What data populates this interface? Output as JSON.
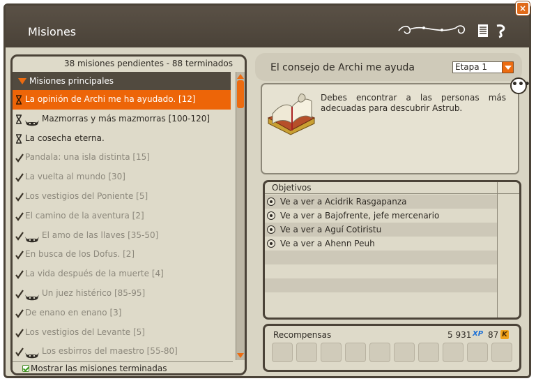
{
  "window": {
    "title": "Misiones",
    "close_label": "×"
  },
  "left": {
    "count_text": "38 misiones pendientes - 88 terminados",
    "category_label": "Misiones principales",
    "quests": [
      {
        "label": "La opinión de Archi me ha ayudado. [12]",
        "state": "selected",
        "icon": "hourglass-icon",
        "monster": false
      },
      {
        "label": "Mazmorras y más mazmorras [100-120]",
        "state": "active",
        "icon": "hourglass-icon",
        "monster": true
      },
      {
        "label": "La cosecha eterna.",
        "state": "active",
        "icon": "hourglass-icon",
        "monster": false
      },
      {
        "label": "Pandala: una isla distinta [15]",
        "state": "done",
        "icon": "checkmark-icon",
        "monster": false
      },
      {
        "label": "La vuelta al mundo [30]",
        "state": "done",
        "icon": "checkmark-icon",
        "monster": false
      },
      {
        "label": "Los vestigios del Poniente [5]",
        "state": "done",
        "icon": "checkmark-icon",
        "monster": false
      },
      {
        "label": "El camino de la aventura [2]",
        "state": "done",
        "icon": "checkmark-icon",
        "monster": false
      },
      {
        "label": "El amo de las llaves [35-50]",
        "state": "done",
        "icon": "checkmark-icon",
        "monster": true
      },
      {
        "label": "En busca de los Dofus. [2]",
        "state": "done",
        "icon": "checkmark-icon",
        "monster": false
      },
      {
        "label": "La vida después de la muerte [4]",
        "state": "done",
        "icon": "checkmark-icon",
        "monster": false
      },
      {
        "label": "Un juez histérico [85-95]",
        "state": "done",
        "icon": "checkmark-icon",
        "monster": true
      },
      {
        "label": "De enano en enano [3]",
        "state": "done",
        "icon": "checkmark-icon",
        "monster": false
      },
      {
        "label": "Los vestigios del Levante [5]",
        "state": "done",
        "icon": "checkmark-icon",
        "monster": false
      },
      {
        "label": "Los esbirros del maestro [55-80]",
        "state": "done",
        "icon": "checkmark-icon",
        "monster": true
      }
    ],
    "show_finished_label": "Mostrar las misiones terminadas"
  },
  "detail": {
    "quest_title": "El consejo de Archi me ayuda",
    "stage_value": "Etapa 1",
    "description": "Debes encontrar a las personas más adecuadas para descubrir Astrub.",
    "more_label": "•••",
    "objectives_label": "Objetivos",
    "objectives": [
      "Ve a ver a Acidrik Rasgapanza",
      "Ve a ver a Bajofrente, jefe mercenario",
      "Ve a ver a Aguí Cotiristu",
      "Ve a ver a Ahenn Peuh",
      "",
      "",
      "",
      ""
    ],
    "rewards_label": "Recompensas",
    "xp_value": "5 931",
    "xp_icon_text": "XP",
    "kamas_value": "87",
    "kamas_icon_text": "K"
  },
  "colors": {
    "accent": "#ec6b10",
    "header_bg": "#4b4338",
    "panel_bg": "#dedac9"
  }
}
